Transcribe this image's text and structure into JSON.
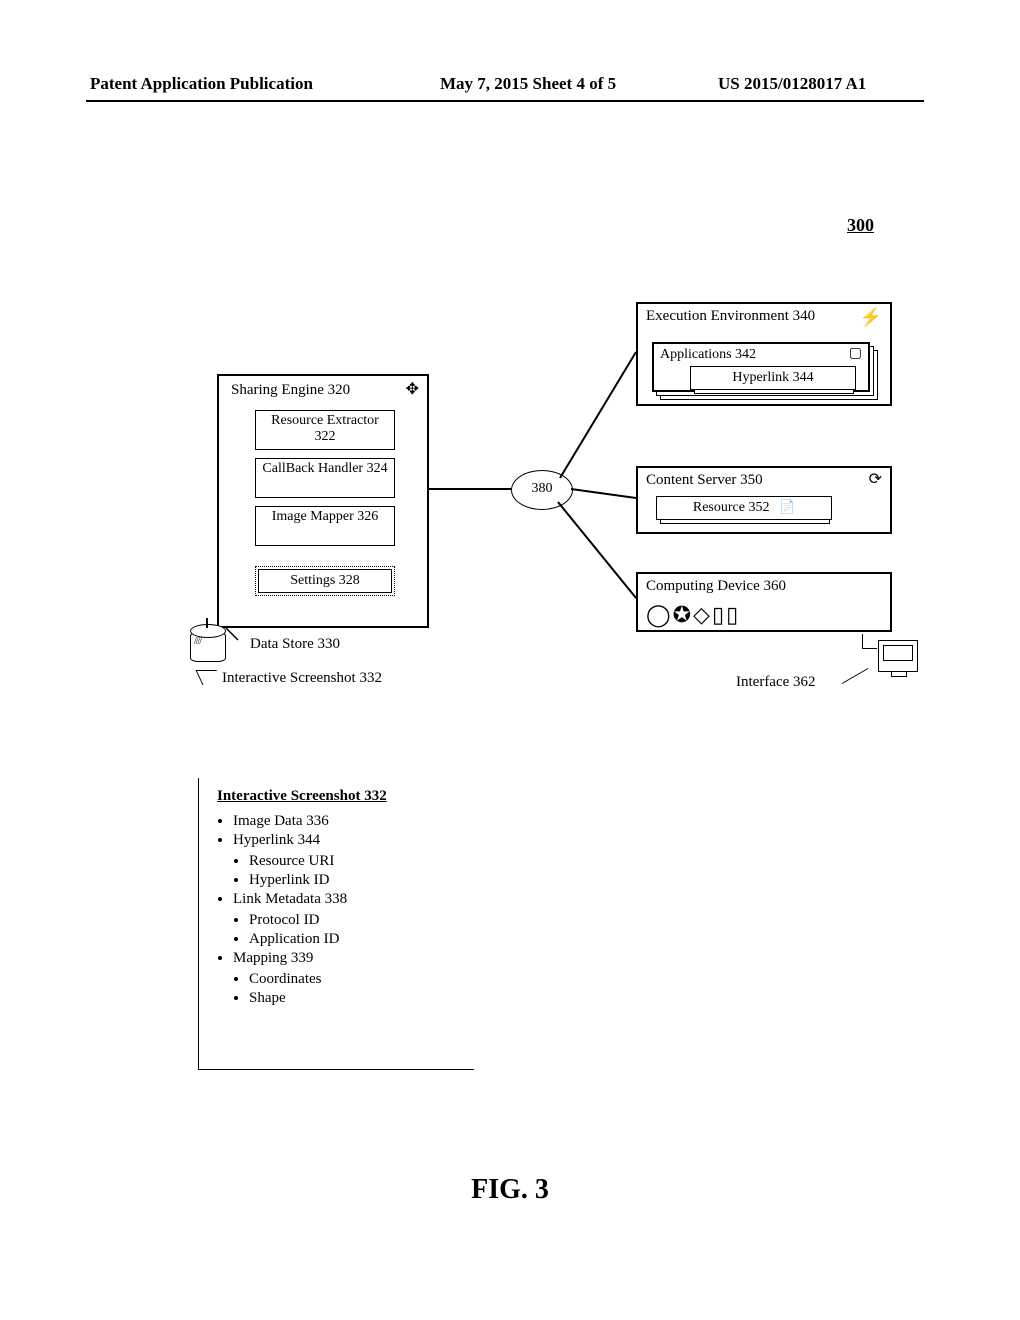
{
  "header": {
    "left": "Patent Application Publication",
    "mid": "May 7, 2015   Sheet 4 of 5",
    "right": "US 2015/0128017 A1"
  },
  "figure_number_global": "300",
  "figure_label": "FIG. 3",
  "sharing_engine": {
    "title": "Sharing Engine 320",
    "resource_extractor": "Resource Extractor 322",
    "callback_handler": "CallBack Handler 324",
    "image_mapper": "Image Mapper 326",
    "settings": "Settings 328",
    "icon_name": "puzzle-piece"
  },
  "data_store": {
    "label": "Data Store 330",
    "sub": "Interactive Screenshot 332"
  },
  "network_label": "380",
  "exec_env": {
    "title": "Execution Environment 340",
    "applications": "Applications 342",
    "hyperlink": "Hyperlink 344",
    "icon_name": "lightning"
  },
  "content_server": {
    "title": "Content Server 350",
    "resource": "Resource 352",
    "icon_name": "globe",
    "res_icon": "page"
  },
  "computing_device": {
    "title": "Computing Device 360",
    "interface_label": "Interface 362"
  },
  "detail": {
    "title": "Interactive Screenshot 332",
    "items": {
      "image_data": "Image Data 336",
      "hyperlink": "Hyperlink 344",
      "hyperlink_sub1": "Resource URI",
      "hyperlink_sub2": "Hyperlink ID",
      "link_meta": "Link Metadata 338",
      "link_sub1": "Protocol ID",
      "link_sub2": "Application ID",
      "mapping": "Mapping 339",
      "map_sub1": "Coordinates",
      "map_sub2": "Shape"
    }
  }
}
